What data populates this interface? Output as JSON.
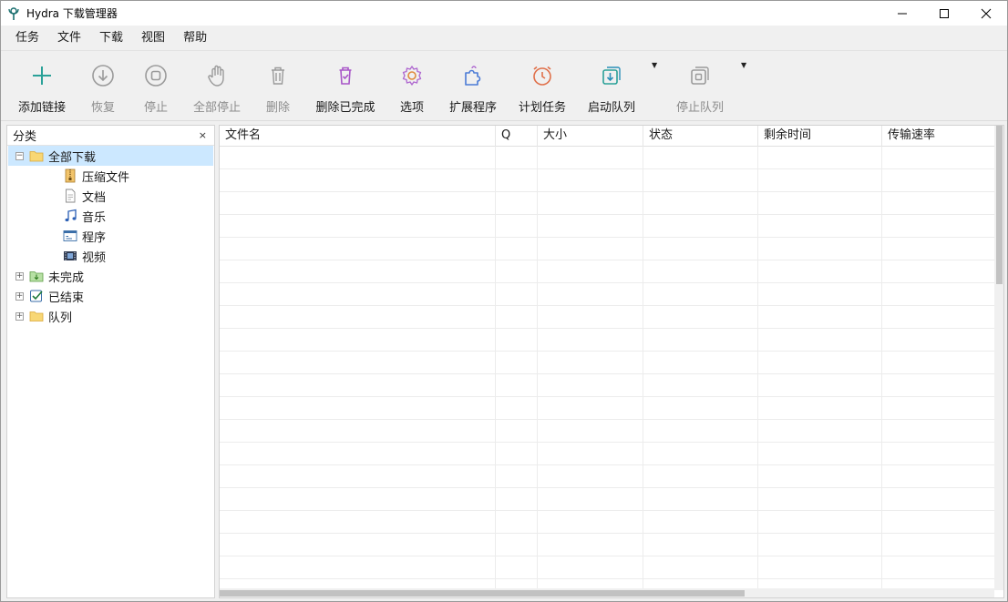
{
  "window": {
    "title": "Hydra 下载管理器"
  },
  "menu": [
    "任务",
    "文件",
    "下载",
    "视图",
    "帮助"
  ],
  "toolbar": {
    "add": "添加链接",
    "resume": "恢复",
    "stop": "停止",
    "stop_all": "全部停止",
    "delete": "删除",
    "delete_completed": "删除已完成",
    "options": "选项",
    "extensions": "扩展程序",
    "scheduler": "计划任务",
    "start_queue": "启动队列",
    "stop_queue": "停止队列"
  },
  "sidebar": {
    "title": "分类",
    "close_glyph": "×",
    "items": [
      {
        "label": "全部下载",
        "icon": "folder-open-icon"
      },
      {
        "label": "压缩文件",
        "icon": "archive-icon"
      },
      {
        "label": "文档",
        "icon": "document-icon"
      },
      {
        "label": "音乐",
        "icon": "music-icon"
      },
      {
        "label": "程序",
        "icon": "program-icon"
      },
      {
        "label": "视频",
        "icon": "video-icon"
      },
      {
        "label": "未完成",
        "icon": "download-folder-icon"
      },
      {
        "label": "已结束",
        "icon": "checkbox-icon"
      },
      {
        "label": "队列",
        "icon": "folder-icon"
      }
    ]
  },
  "table": {
    "columns": [
      "文件名",
      "Q",
      "大小",
      "状态",
      "剩余时间",
      "传输速率"
    ]
  }
}
